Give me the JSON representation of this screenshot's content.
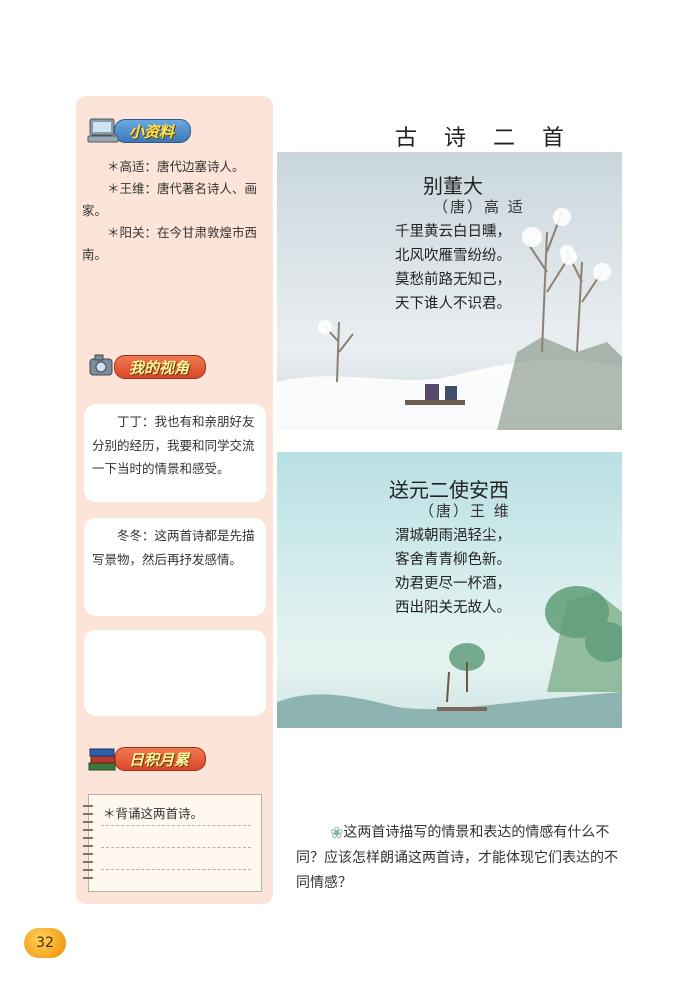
{
  "sidebar": {
    "reference": {
      "title": "小资料",
      "items": [
        "＊高适：唐代边塞诗人。",
        "＊王维：唐代著名诗人、画家。",
        "＊阳关：在今甘肃敦煌市西南。"
      ]
    },
    "my_view": {
      "title": "我的视角",
      "bubbles": [
        "丁丁：我也有和亲朋好友分别的经历，我要和同学交流一下当时的情景和感受。",
        "冬冬：这两首诗都是先描写景物，然后再抒发感情。",
        ""
      ]
    },
    "accumulate": {
      "title": "日积月累",
      "note": "＊背诵这两首诗。"
    }
  },
  "main": {
    "title": "古 诗 二 首",
    "poems": [
      {
        "title": "别董大",
        "author": "（唐）高 适",
        "lines": [
          "千里黄云白日曛，",
          "北风吹雁雪纷纷。",
          "莫愁前路无知己，",
          "天下谁人不识君。"
        ]
      },
      {
        "title": "送元二使安西",
        "author": "（唐）王 维",
        "lines": [
          "渭城朝雨浥轻尘，",
          "客舍青青柳色新。",
          "劝君更尽一杯酒，",
          "西出阳关无故人。"
        ]
      }
    ],
    "question": "这两首诗描写的情景和表达的情感有什么不同？应该怎样朗诵这两首诗，才能体现它们表达的不同情感？"
  },
  "page_number": "32"
}
